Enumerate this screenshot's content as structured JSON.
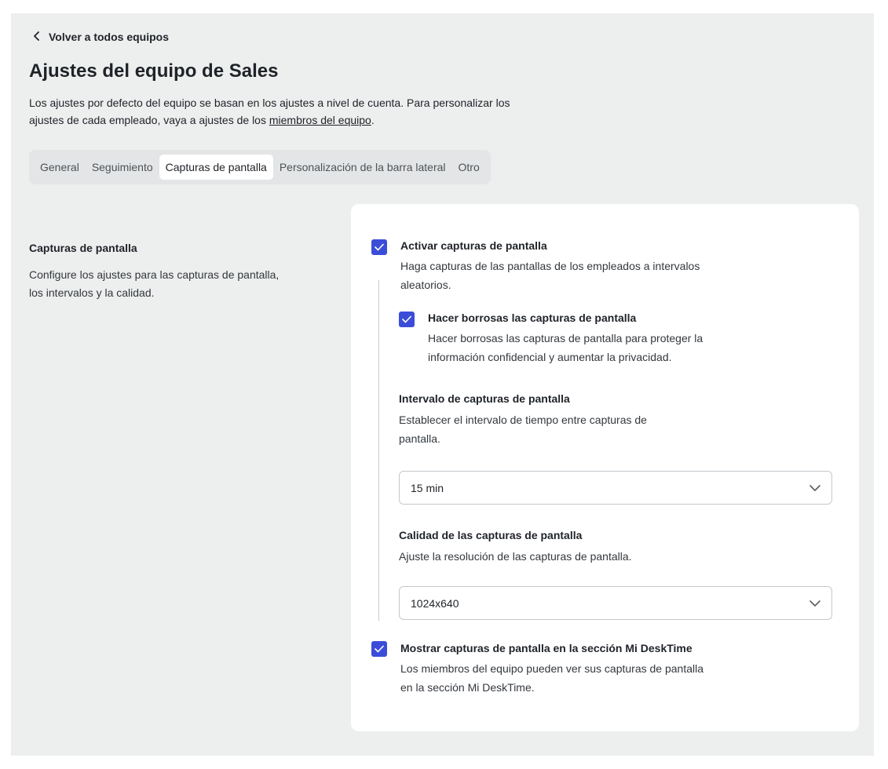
{
  "header": {
    "back_label": "Volver a todos equipos",
    "title": "Ajustes del equipo de Sales",
    "description_before": "Los ajustes por defecto del equipo se basan en los ajustes a nivel de cuenta. Para personalizar los ajustes de cada empleado, vaya a ajustes de los ",
    "description_link": "miembros del equipo",
    "description_after": "."
  },
  "tabs": [
    {
      "label": "General"
    },
    {
      "label": "Seguimiento"
    },
    {
      "label": "Capturas de pantalla"
    },
    {
      "label": "Personalización de la barra lateral"
    },
    {
      "label": "Otro"
    }
  ],
  "active_tab": "Capturas de pantalla",
  "section": {
    "title": "Capturas de pantalla",
    "description": "Configure los ajustes para las capturas de pantalla, los intervalos y la calidad."
  },
  "options": {
    "enable": {
      "checked": true,
      "title": "Activar capturas de pantalla",
      "description": "Haga capturas de las pantallas de los empleados a intervalos aleatorios."
    },
    "blur": {
      "checked": true,
      "title": "Hacer borrosas las capturas de pantalla",
      "description": "Hacer borrosas las capturas de pantalla para proteger la información confidencial y aumentar la privacidad."
    },
    "interval": {
      "title": "Intervalo de capturas de pantalla",
      "description": "Establecer el intervalo de tiempo entre capturas de pantalla.",
      "value": "15 min"
    },
    "quality": {
      "title": "Calidad de las capturas de pantalla",
      "description": "Ajuste la resolución de las capturas de pantalla.",
      "value": "1024x640"
    },
    "show_in_desktime": {
      "checked": true,
      "title": "Mostrar capturas de pantalla en la sección Mi DeskTime",
      "description": "Los miembros del equipo pueden ver sus capturas de pantalla en la sección Mi DeskTime."
    }
  },
  "colors": {
    "accent": "#3b4dd8",
    "page_background": "#edeeee",
    "card_background": "#ffffff"
  },
  "icons": {
    "back": "chevron-left-icon",
    "check": "check-icon",
    "dropdown": "chevron-down-icon"
  }
}
